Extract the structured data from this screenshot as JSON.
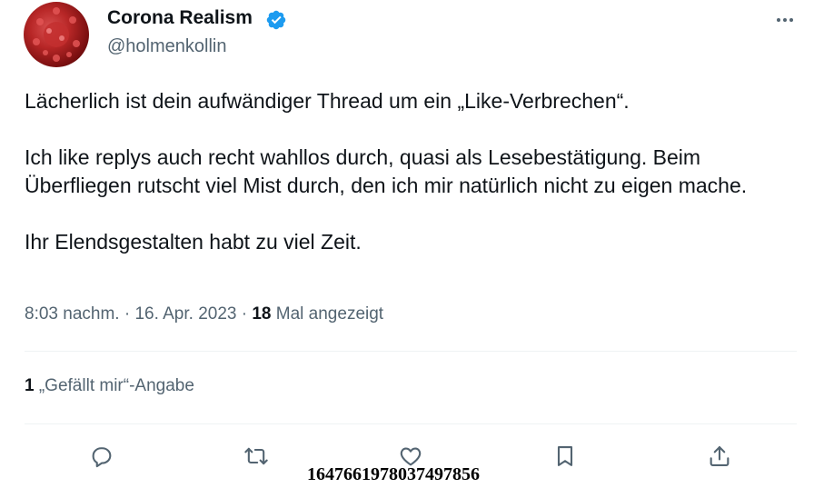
{
  "author": {
    "name": "Corona Realism",
    "handle": "@holmenkollin",
    "avatar_icon": "coronavirus-avatar",
    "verified_icon": "verified-badge-icon",
    "verified_color": "#1d9bf0"
  },
  "tweet": {
    "paragraphs": [
      "Lächerlich ist dein aufwändiger Thread um ein „Like-Verbrechen“.",
      "Ich like replys auch recht wahllos durch, quasi als Lesebestätigung. Beim Überfliegen rutscht viel Mist durch, den ich mir natürlich nicht zu eigen mache.",
      "Ihr Elendsgestalten habt zu viel Zeit."
    ],
    "time": "8:03 nachm.",
    "separator": "·",
    "date": "16. Apr. 2023",
    "views_count": "18",
    "views_label": "Mal angezeigt"
  },
  "engagement": {
    "likes_count": "1",
    "likes_label": "„Gefällt mir“-Angabe"
  },
  "actions": [
    "reply-icon",
    "retweet-icon",
    "like-icon",
    "bookmark-icon",
    "share-icon"
  ],
  "overlay_id": "1647661978037497856",
  "colors": {
    "text": "#0f1419",
    "secondary": "#536471",
    "divider": "#eff3f4"
  }
}
